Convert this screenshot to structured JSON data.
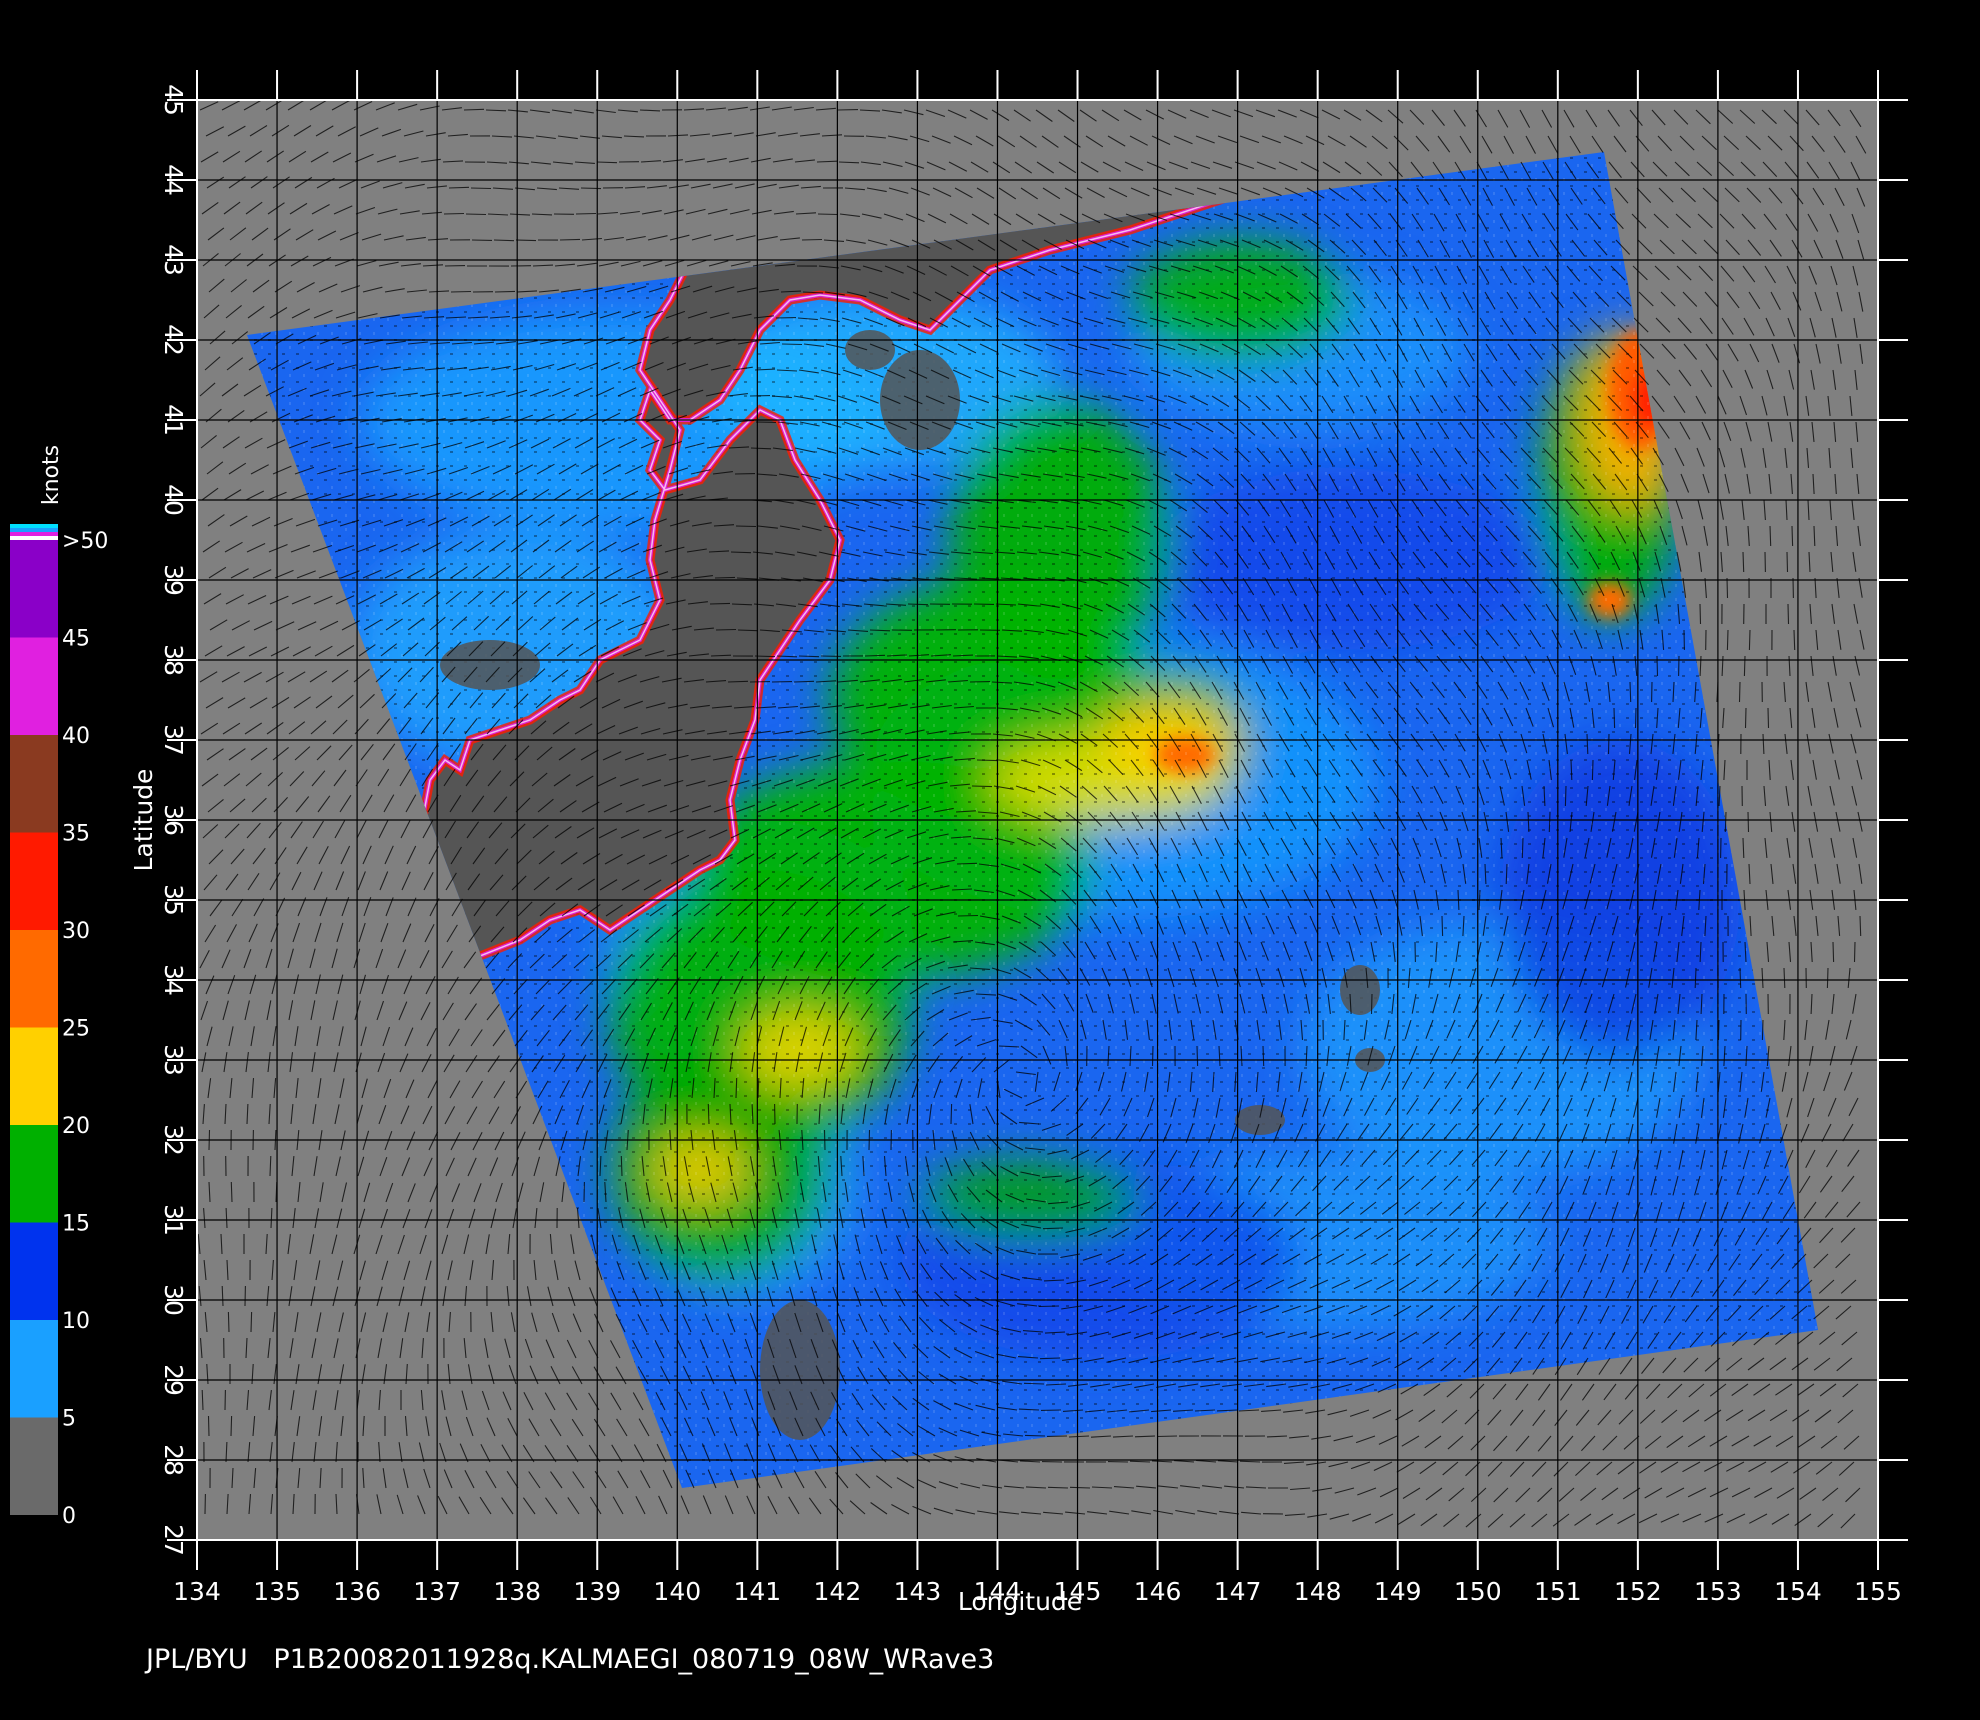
{
  "map": {
    "x_axis_label": "Longitude",
    "y_axis_label": "Latitude",
    "x_ticks": [
      "134",
      "135",
      "136",
      "137",
      "138",
      "139",
      "140",
      "141",
      "142",
      "143",
      "144",
      "145",
      "146",
      "147",
      "148",
      "149",
      "150",
      "151",
      "152",
      "153",
      "154",
      "155"
    ],
    "y_ticks": [
      "27",
      "28",
      "29",
      "30",
      "31",
      "32",
      "33",
      "34",
      "35",
      "36",
      "37",
      "38",
      "39",
      "40",
      "41",
      "42",
      "43",
      "44",
      "45"
    ],
    "lon_range": [
      134,
      155
    ],
    "lat_range": [
      27,
      45
    ],
    "background_color": "#808080",
    "land_color": "#555555",
    "grid_color": "#000000"
  },
  "legend": {
    "title": "knots",
    "labels": [
      "0",
      "5",
      "10",
      "15",
      "20",
      "25",
      "30",
      "35",
      "40",
      "45",
      ">50"
    ],
    "bands": [
      {
        "from": 0,
        "to": 5,
        "color": "#6a6a6a"
      },
      {
        "from": 5,
        "to": 10,
        "color": "#1aa0ff"
      },
      {
        "from": 10,
        "to": 15,
        "color": "#0033ee"
      },
      {
        "from": 15,
        "to": 20,
        "color": "#00b000"
      },
      {
        "from": 20,
        "to": 25,
        "color": "#ffd000"
      },
      {
        "from": 25,
        "to": 30,
        "color": "#ff6a00"
      },
      {
        "from": 30,
        "to": 35,
        "color": "#ff1a00"
      },
      {
        "from": 35,
        "to": 40,
        "color": "#8a3a20"
      },
      {
        "from": 40,
        "to": 45,
        "color": "#e020e0"
      },
      {
        "from": 45,
        "to": 50,
        "color": "#8a00c8"
      }
    ]
  },
  "footer": {
    "caption": "JPL/BYU   P1B20082011928q.KALMAEGI_080719_08W_WRave3"
  }
}
